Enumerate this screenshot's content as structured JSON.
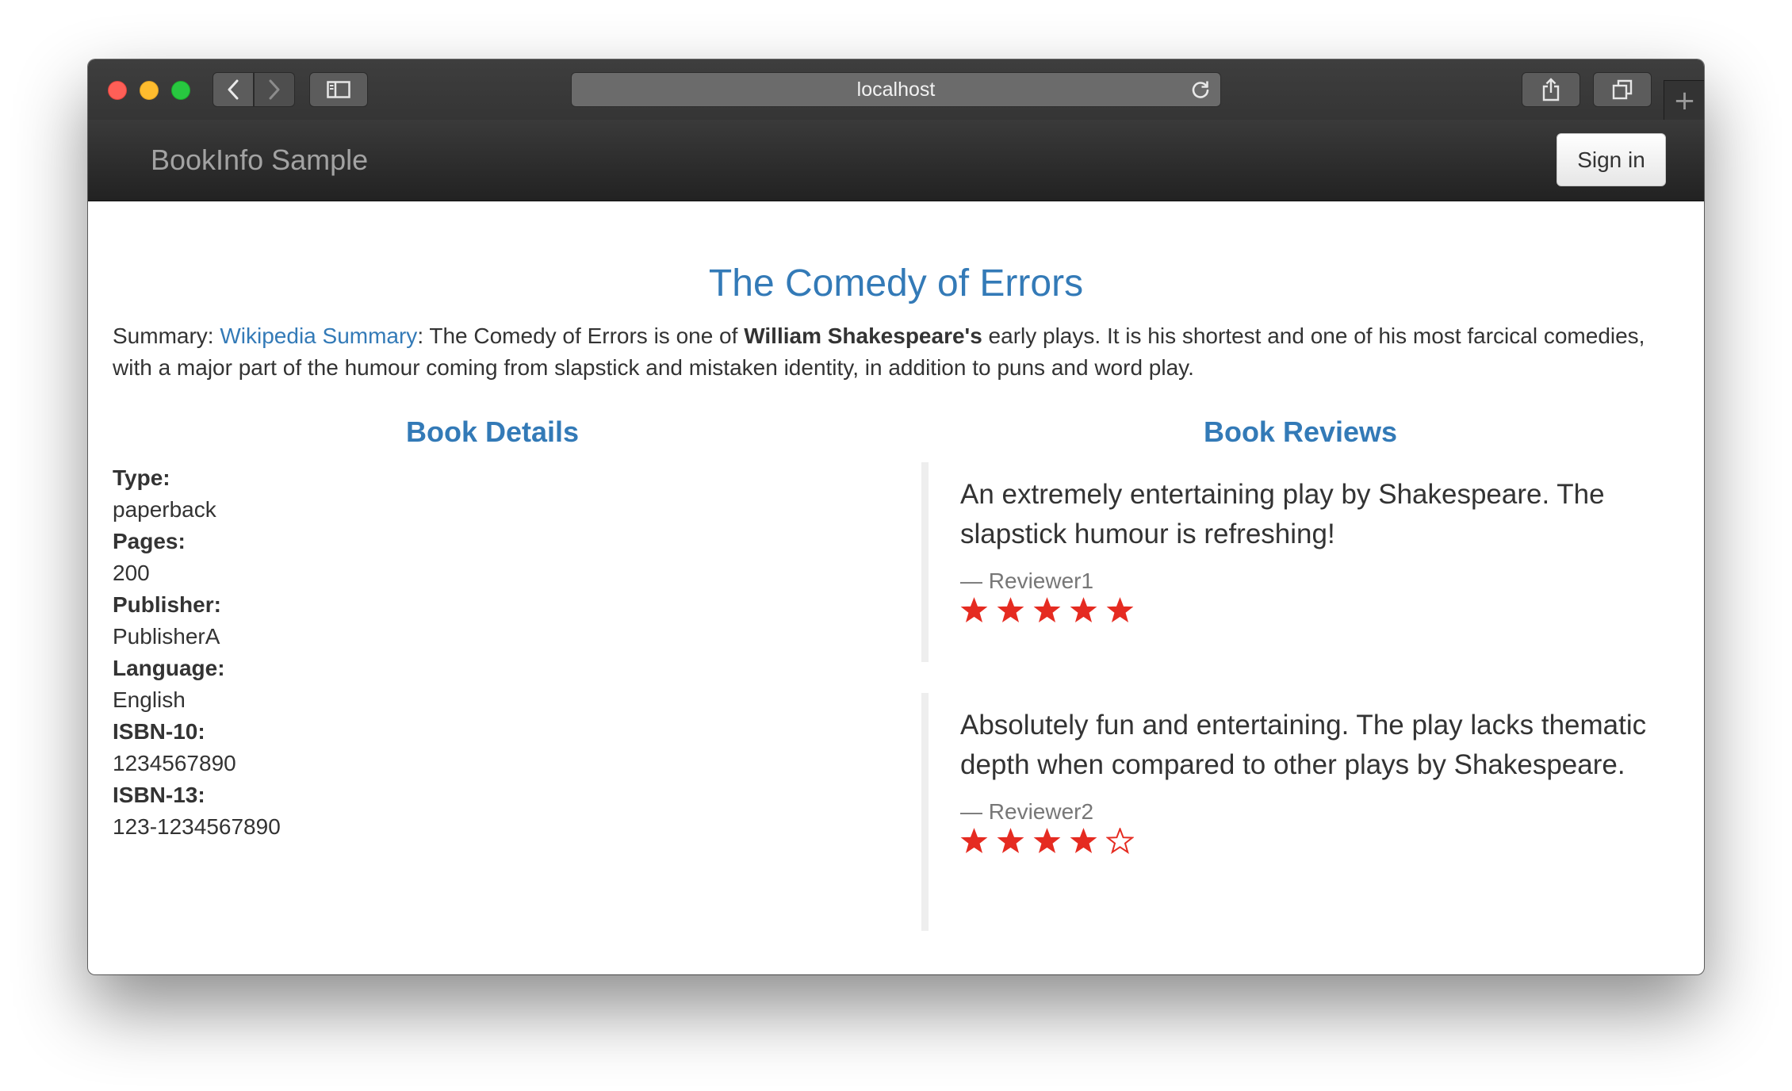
{
  "browser": {
    "url": "localhost",
    "icons": [
      "back-icon",
      "forward-icon",
      "sidebar-icon",
      "reload-icon",
      "share-icon",
      "tabs-icon",
      "plus-icon"
    ]
  },
  "navbar": {
    "brand": "BookInfo Sample",
    "sign_in_label": "Sign in"
  },
  "book": {
    "title": "The Comedy of Errors",
    "summary_label": "Summary: ",
    "summary_link": "Wikipedia Summary",
    "summary_mid": ": The Comedy of Errors is one of ",
    "summary_bold": "William Shakespeare's",
    "summary_end": " early plays. It is his shortest and one of his most farcical comedies, with a major part of the humour coming from slapstick and mistaken identity, in addition to puns and word play."
  },
  "details": {
    "heading": "Book Details",
    "fields": [
      {
        "label": "Type:",
        "value": "paperback"
      },
      {
        "label": "Pages:",
        "value": "200"
      },
      {
        "label": "Publisher:",
        "value": "PublisherA"
      },
      {
        "label": "Language:",
        "value": "English"
      },
      {
        "label": "ISBN-10:",
        "value": "1234567890"
      },
      {
        "label": "ISBN-13:",
        "value": "123-1234567890"
      }
    ]
  },
  "reviews": {
    "heading": "Book Reviews",
    "star_color": "#e52b21",
    "items": [
      {
        "text": "An extremely entertaining play by Shakespeare. The slapstick humour is refreshing!",
        "reviewer": "— Reviewer1",
        "rating": 5,
        "max_rating": 5
      },
      {
        "text": "Absolutely fun and entertaining. The play lacks thematic depth when compared to other plays by Shakespeare.",
        "reviewer": "— Reviewer2",
        "rating": 4,
        "max_rating": 5
      }
    ]
  },
  "colors": {
    "accent": "#337ab7",
    "navbar": "#222222"
  }
}
